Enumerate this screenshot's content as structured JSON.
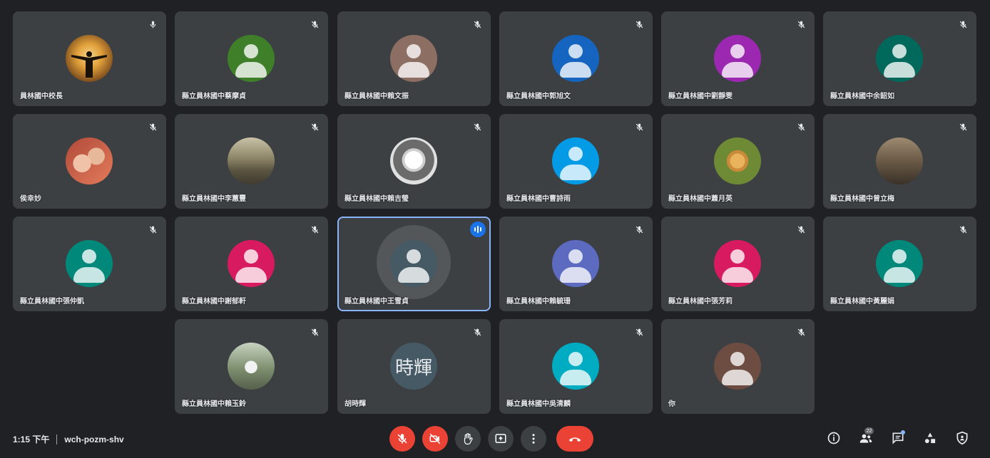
{
  "participants": [
    {
      "name": "員林國中校長",
      "color": "#7a5a2e",
      "photo": "sunset-silhouette",
      "mic_muted": false,
      "speaking": false
    },
    {
      "name": "縣立員林國中蔡摩貞",
      "color": "#3f7f2a",
      "photo": null,
      "mic_muted": true,
      "speaking": false
    },
    {
      "name": "縣立員林國中賴文振",
      "color": "#8d6e63",
      "photo": null,
      "mic_muted": true,
      "speaking": false
    },
    {
      "name": "縣立員林國中郭旭文",
      "color": "#1565c0",
      "photo": null,
      "mic_muted": true,
      "speaking": false
    },
    {
      "name": "縣立員林國中劉靜雯",
      "color": "#9c27b0",
      "photo": null,
      "mic_muted": true,
      "speaking": false
    },
    {
      "name": "縣立員林國中余韶如",
      "color": "#00695c",
      "photo": null,
      "mic_muted": true,
      "speaking": false
    },
    {
      "name": "侯幸妙",
      "color": "#8a5a4a",
      "photo": "two-people",
      "mic_muted": true,
      "speaking": false
    },
    {
      "name": "縣立員林國中李蕙豐",
      "color": "#6d6650",
      "photo": "landscape",
      "mic_muted": true,
      "speaking": false
    },
    {
      "name": "縣立員林國中賴吉瑩",
      "color": "#bdbdbd",
      "photo": "sketch-portrait",
      "mic_muted": true,
      "speaking": false
    },
    {
      "name": "縣立員林國中曹詩雨",
      "color": "#039be5",
      "photo": null,
      "mic_muted": true,
      "speaking": false
    },
    {
      "name": "縣立員林國中蕭月英",
      "color": "#5b7f32",
      "photo": "dog",
      "mic_muted": true,
      "speaking": false
    },
    {
      "name": "縣立員林國中曾立梅",
      "color": "#6d5d4b",
      "photo": "portrait",
      "mic_muted": true,
      "speaking": false
    },
    {
      "name": "縣立員林國中張仲凱",
      "color": "#00897b",
      "photo": null,
      "mic_muted": true,
      "speaking": false
    },
    {
      "name": "縣立員林國中謝郁軒",
      "color": "#d81b60",
      "photo": null,
      "mic_muted": true,
      "speaking": false
    },
    {
      "name": "縣立員林國中王雪貞",
      "color": "#455a64",
      "photo": null,
      "mic_muted": false,
      "speaking": true
    },
    {
      "name": "縣立員林國中賴毓珊",
      "color": "#5c6bc0",
      "photo": null,
      "mic_muted": true,
      "speaking": false
    },
    {
      "name": "縣立員林國中張芳莉",
      "color": "#d81b60",
      "photo": null,
      "mic_muted": true,
      "speaking": false
    },
    {
      "name": "縣立員林國中黃麗娟",
      "color": "#00897b",
      "photo": null,
      "mic_muted": true,
      "speaking": false
    },
    {
      "name": "縣立員林國中賴玉鈴",
      "color": "#7a8a78",
      "photo": "person-outdoor",
      "mic_muted": true,
      "speaking": false
    },
    {
      "name": "胡時輝",
      "color": "#455a64",
      "photo": null,
      "initials": "時輝",
      "mic_muted": true,
      "speaking": false
    },
    {
      "name": "縣立員林國中吳清麟",
      "color": "#00acc1",
      "photo": null,
      "mic_muted": true,
      "speaking": false
    },
    {
      "name": "你",
      "color": "#6d4c41",
      "photo": null,
      "mic_muted": true,
      "speaking": false
    }
  ],
  "footer": {
    "time": "1:15 下午",
    "meeting_code": "wch-pozm-shv"
  },
  "controls": [
    {
      "name": "mic-toggle-button",
      "icon": "mic-off-icon",
      "state": "off"
    },
    {
      "name": "camera-toggle-button",
      "icon": "videocam-off-icon",
      "state": "off"
    },
    {
      "name": "raise-hand-button",
      "icon": "hand-icon",
      "state": "neutral"
    },
    {
      "name": "present-button",
      "icon": "present-icon",
      "state": "neutral"
    },
    {
      "name": "more-options-button",
      "icon": "more-vert-icon",
      "state": "neutral"
    },
    {
      "name": "leave-call-button",
      "icon": "call-end-icon",
      "state": "danger"
    }
  ],
  "right_controls": [
    {
      "name": "meeting-details-button",
      "icon": "info-icon"
    },
    {
      "name": "people-button",
      "icon": "people-icon",
      "badge": "22"
    },
    {
      "name": "chat-button",
      "icon": "chat-icon"
    },
    {
      "name": "activities-button",
      "icon": "activities-icon"
    },
    {
      "name": "host-controls-button",
      "icon": "shield-icon"
    }
  ],
  "colors": {
    "background": "#202124",
    "tile": "#3c4043",
    "active_outline": "#8ab4f8",
    "danger": "#ea4335",
    "speaking": "#1a73e8"
  }
}
